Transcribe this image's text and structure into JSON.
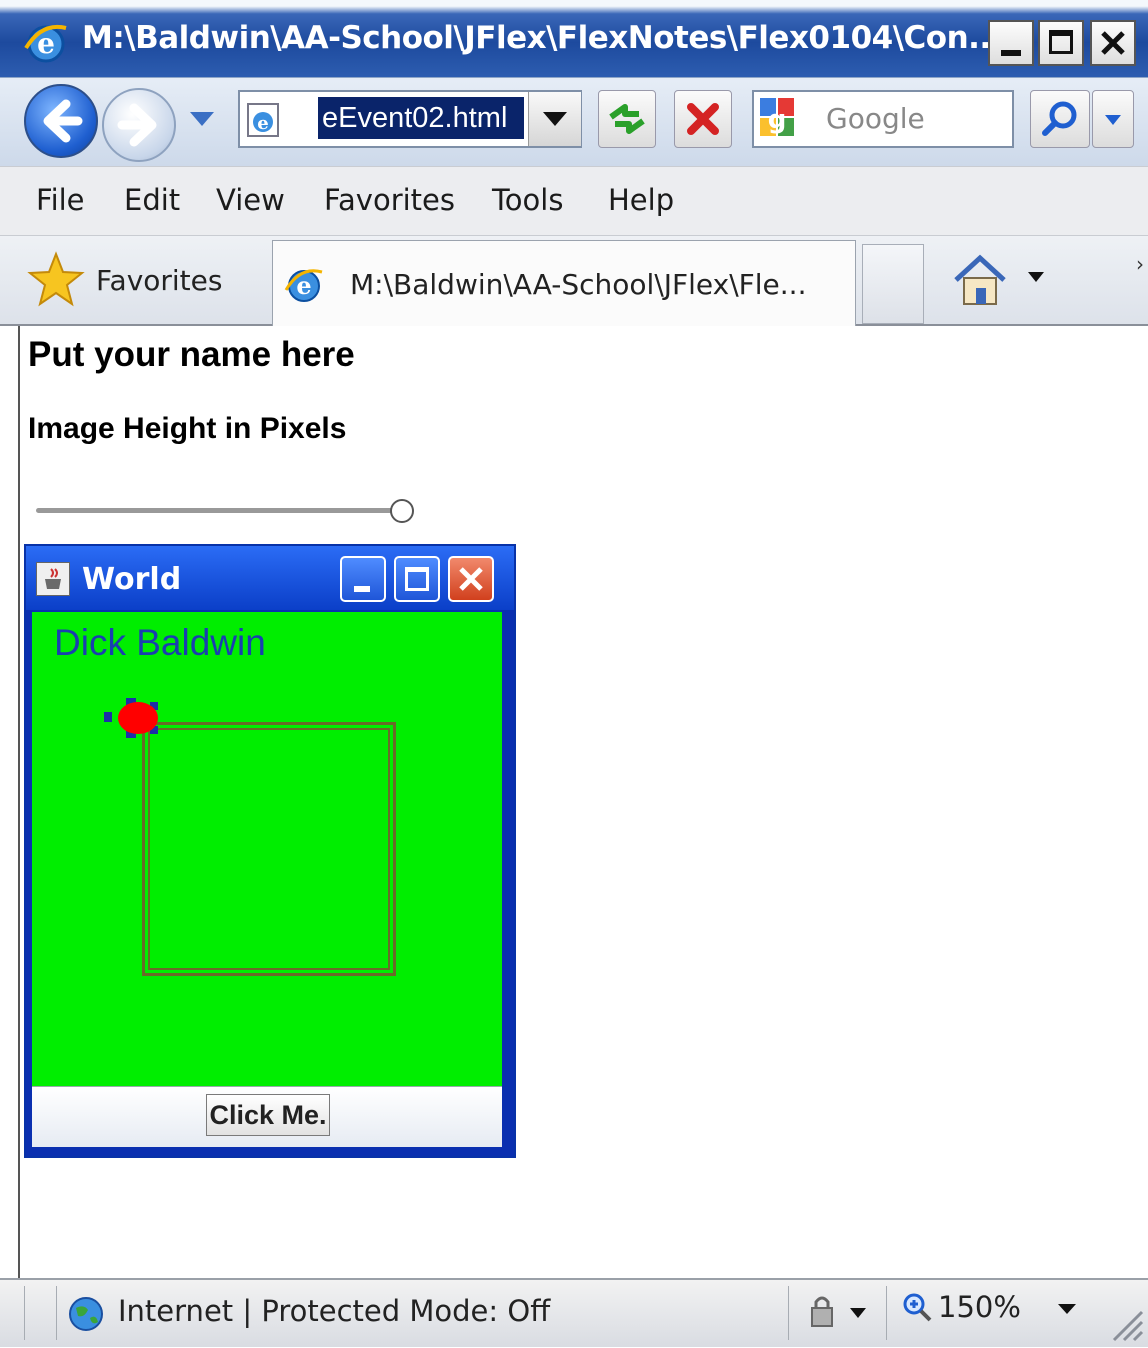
{
  "window": {
    "title": "M:\\Baldwin\\AA-School\\JFlex\\FlexNotes\\Flex0104\\Con...",
    "icon": "ie-icon",
    "controls": [
      "minimize-icon",
      "maximize-icon",
      "close-icon"
    ]
  },
  "navigation": {
    "address_value": "eEvent02.html",
    "search_placeholder": "Google"
  },
  "menu": {
    "items": [
      "File",
      "Edit",
      "View",
      "Favorites",
      "Tools",
      "Help"
    ]
  },
  "favorites_bar": {
    "favorites_label": "Favorites",
    "tab_title": "M:\\Baldwin\\AA-School\\JFlex\\Fle..."
  },
  "page": {
    "heading": "Put your name here",
    "slider_label": "Image Height in Pixels",
    "slider_value_fraction": 1.0
  },
  "java_window": {
    "title": "World",
    "name_text": "Dick Baldwin",
    "button_label": "Click Me.",
    "background_color": "#00ee00"
  },
  "status_bar": {
    "zone_text": "Internet | Protected Mode: Off",
    "zoom": "150%"
  },
  "colors": {
    "title_bar": "#1d4a9e",
    "selection": "#0a246a",
    "java_canvas": "#00ee00",
    "name_text": "#1a3fb0",
    "turtle": "#ff0000"
  }
}
